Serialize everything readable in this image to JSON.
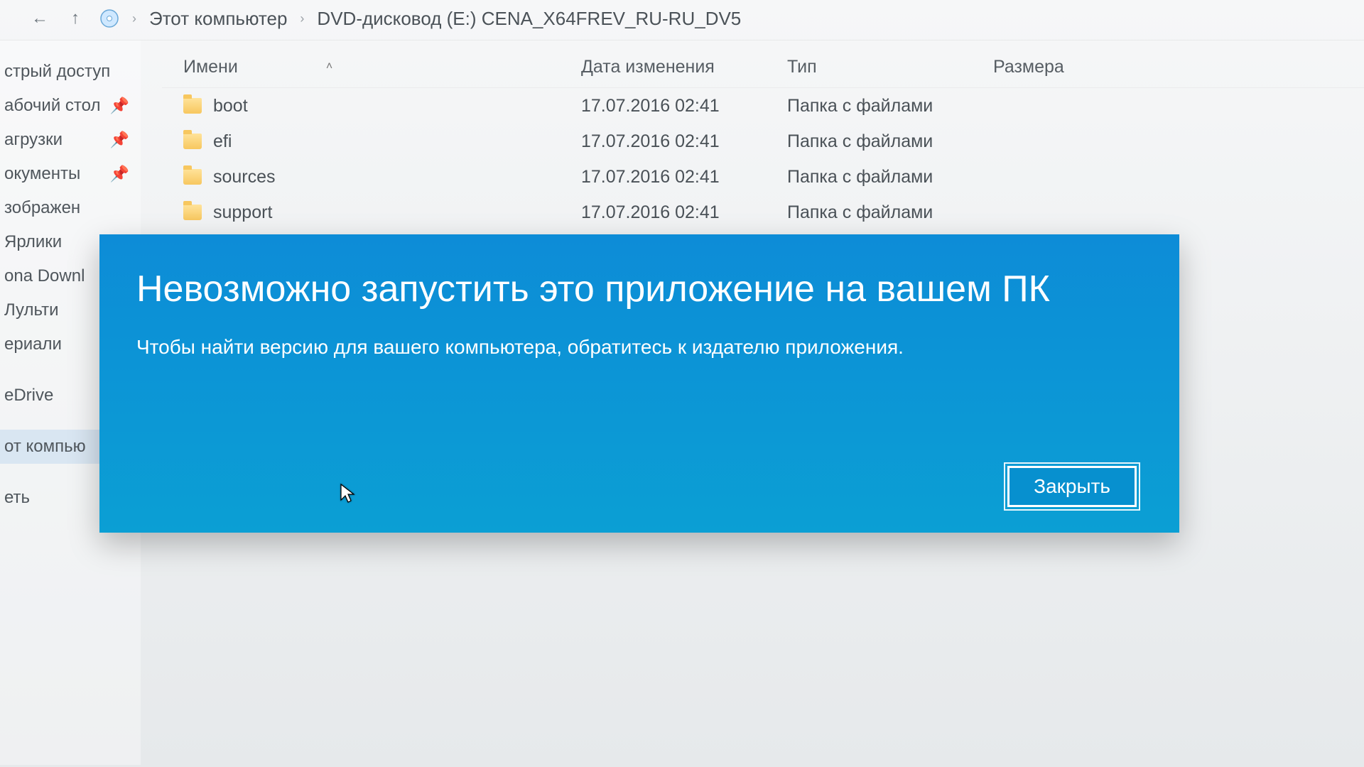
{
  "breadcrumbs": {
    "part1": "Этот компьютер",
    "part2": "DVD-дисковод (E:) CENA_X64FREV_RU-RU_DV5"
  },
  "columns": {
    "name": "Имени",
    "date": "Дата изменения",
    "type": "Тип",
    "size": "Размера"
  },
  "sidebar": {
    "items": [
      {
        "label": "стрый доступ",
        "pinned": false
      },
      {
        "label": "абочий стол",
        "pinned": true
      },
      {
        "label": "агрузки",
        "pinned": true
      },
      {
        "label": "окументы",
        "pinned": true
      },
      {
        "label": "зображен",
        "pinned": false
      },
      {
        "label": "Ярлики",
        "pinned": false
      },
      {
        "label": "ona Downl",
        "pinned": false
      },
      {
        "label": "Лульти",
        "pinned": false
      },
      {
        "label": "ериали",
        "pinned": false
      }
    ],
    "onedrive": "eDrive",
    "thispc": "от компью",
    "network": "еть"
  },
  "files": [
    {
      "name": "boot",
      "date": "17.07.2016 02:41",
      "type": "Папка с файлами"
    },
    {
      "name": "efi",
      "date": "17.07.2016 02:41",
      "type": "Папка с файлами"
    },
    {
      "name": "sources",
      "date": "17.07.2016 02:41",
      "type": "Папка с файлами"
    },
    {
      "name": "support",
      "date": "17.07.2016 02:41",
      "type": "Папка с файлами"
    }
  ],
  "dialog": {
    "title": "Невозможно запустить это приложение на вашем ПК",
    "subtitle": "Чтобы найти версию для вашего компьютера, обратитесь к издателю приложения.",
    "close_label": "Закрыть"
  }
}
